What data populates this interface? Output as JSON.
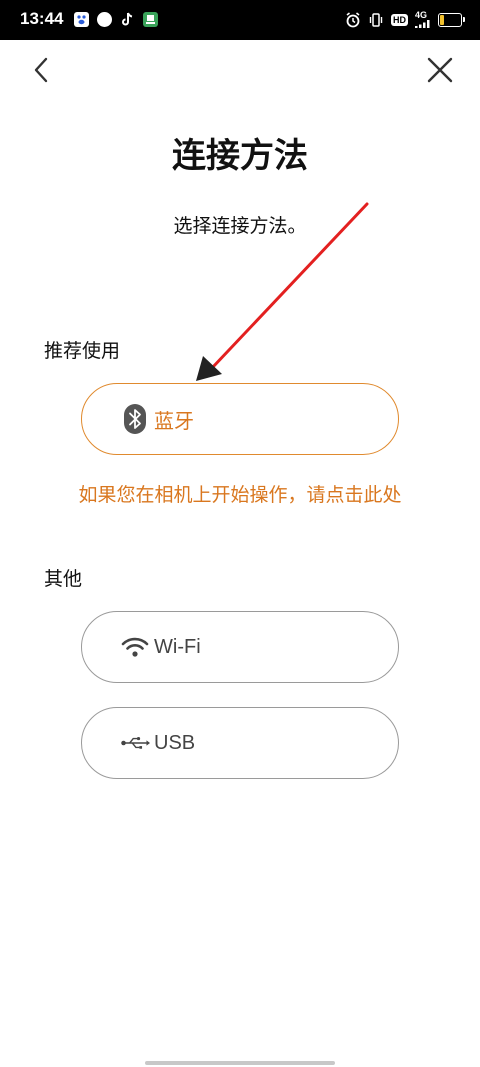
{
  "status_bar": {
    "time": "13:44",
    "network": "4G",
    "hd_label": "HD",
    "battery_text": "17",
    "battery_level": 0.17,
    "battery_color": "#f2c12e",
    "left_icons": [
      "baidu-app-icon",
      "compass-app-icon",
      "tiktok-icon",
      "green-app-icon"
    ],
    "right_icons": [
      "alarm-icon",
      "vibrate-icon",
      "hd-icon",
      "signal-icon",
      "battery-icon"
    ]
  },
  "nav": {
    "back_icon": "chevron-left-icon",
    "close_icon": "close-icon"
  },
  "page": {
    "title": "连接方法",
    "subtitle": "选择连接方法。"
  },
  "recommended": {
    "label": "推荐使用",
    "bluetooth": {
      "icon": "bluetooth-icon",
      "label": "蓝牙"
    },
    "camera_link": "如果您在相机上开始操作，请点击此处"
  },
  "other": {
    "label": "其他",
    "wifi": {
      "icon": "wifi-icon",
      "label": "Wi-Fi"
    },
    "usb": {
      "icon": "usb-icon",
      "label": "USB"
    }
  },
  "colors": {
    "accent": "#d9771f",
    "accent_border": "#e08a2e",
    "neutral_border": "#9a9a9a",
    "annotation_arrow": "#e32020"
  }
}
